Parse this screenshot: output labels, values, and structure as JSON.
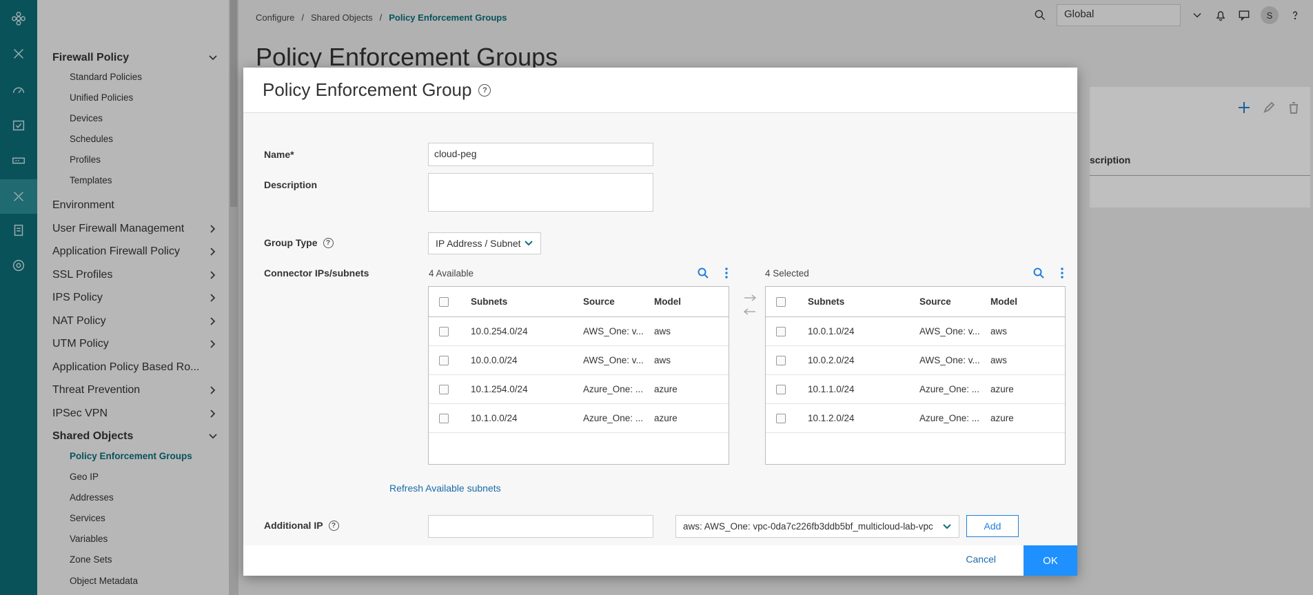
{
  "breadcrumb": [
    "Configure",
    "Shared Objects",
    "Policy Enforcement Groups"
  ],
  "page": {
    "title": "Policy Enforcement Groups"
  },
  "topbar": {
    "scope": "Global",
    "user_initial": "S"
  },
  "bg_table": {
    "col_description": "scription"
  },
  "nav": {
    "firewall_policy": "Firewall Policy",
    "firewall_items": [
      "Standard Policies",
      "Unified Policies",
      "Devices",
      "Schedules",
      "Profiles",
      "Templates"
    ],
    "sections": [
      "Environment",
      "User Firewall Management",
      "Application Firewall Policy",
      "SSL Profiles",
      "IPS Policy",
      "NAT Policy",
      "UTM Policy",
      "Application Policy Based Ro...",
      "Threat Prevention",
      "IPSec VPN"
    ],
    "shared_objects": "Shared Objects",
    "shared_items": [
      "Policy Enforcement Groups",
      "Geo IP",
      "Addresses",
      "Services",
      "Variables",
      "Zone Sets",
      "Object Metadata"
    ]
  },
  "modal": {
    "title": "Policy Enforcement Group",
    "name_label": "Name*",
    "name_value": "cloud-peg",
    "description_label": "Description",
    "description_value": "",
    "group_type_label": "Group Type",
    "group_type_value": "IP Address / Subnet",
    "connector_label": "Connector IPs/subnets",
    "available_count": "4 Available",
    "selected_count": "4 Selected",
    "columns": {
      "subnets": "Subnets",
      "source": "Source",
      "model": "Model"
    },
    "available": [
      {
        "subnet": "10.0.254.0/24",
        "source": "AWS_One: v...",
        "model": "aws"
      },
      {
        "subnet": "10.0.0.0/24",
        "source": "AWS_One: v...",
        "model": "aws"
      },
      {
        "subnet": "10.1.254.0/24",
        "source": "Azure_One: ...",
        "model": "azure"
      },
      {
        "subnet": "10.1.0.0/24",
        "source": "Azure_One: ...",
        "model": "azure"
      }
    ],
    "selected": [
      {
        "subnet": "10.0.1.0/24",
        "source": "AWS_One: v...",
        "model": "aws"
      },
      {
        "subnet": "10.0.2.0/24",
        "source": "AWS_One: v...",
        "model": "aws"
      },
      {
        "subnet": "10.1.1.0/24",
        "source": "Azure_One: ...",
        "model": "azure"
      },
      {
        "subnet": "10.1.2.0/24",
        "source": "Azure_One: ...",
        "model": "azure"
      }
    ],
    "refresh_link": "Refresh Available subnets",
    "additional_ip_label": "Additional IP",
    "additional_ip_value": "",
    "vpc_select": "aws: AWS_One: vpc-0da7c226fb3ddb5bf_multicloud-lab-vpc",
    "add_label": "Add",
    "cancel_label": "Cancel",
    "ok_label": "OK"
  }
}
